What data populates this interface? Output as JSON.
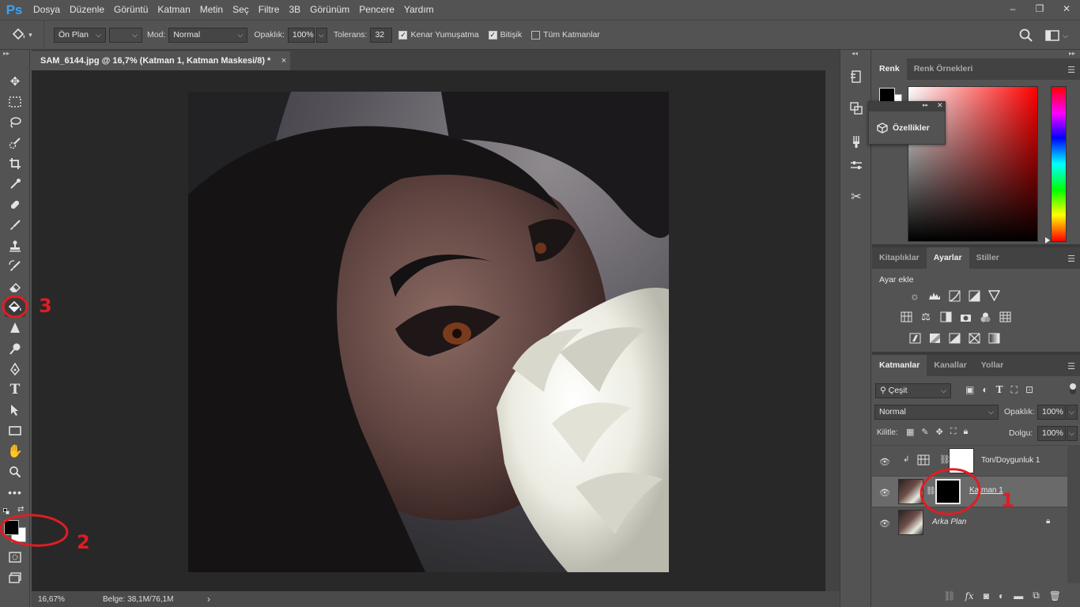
{
  "app": {
    "logo": "Ps"
  },
  "menu": [
    "Dosya",
    "Düzenle",
    "Görüntü",
    "Katman",
    "Metin",
    "Seç",
    "Filtre",
    "3B",
    "Görünüm",
    "Pencere",
    "Yardım"
  ],
  "window_controls": {
    "minimize": "–",
    "restore": "❐",
    "close": "✕"
  },
  "options": {
    "tool_icon": "paint-bucket-icon",
    "fill_source": "Ön Plan",
    "mode_label": "Mod:",
    "mode_value": "Normal",
    "opacity_label": "Opaklık:",
    "opacity_value": "100%",
    "tolerance_label": "Tolerans:",
    "tolerance_value": "32",
    "antialias_label": "Kenar Yumuşatma",
    "antialias_checked": true,
    "contiguous_label": "Bitişik",
    "contiguous_checked": true,
    "all_layers_label": "Tüm Katmanlar",
    "all_layers_checked": false
  },
  "document": {
    "tab_title": "SAM_6144.jpg @ 16,7% (Katman 1, Katman Maskesi/8) *",
    "close": "×",
    "zoom": "16,67%",
    "doc_info": "Belge: 38,1M/76,1M",
    "status_arrow": "›"
  },
  "color_panel": {
    "tabs": [
      "Renk",
      "Renk Örnekleri"
    ],
    "active_tab": "Renk",
    "foreground_color": "#000000",
    "background_color": "#ffffff",
    "picked_hue": "#ff0000"
  },
  "properties_popup": {
    "label": "Özellikler"
  },
  "adjustments_panel": {
    "tabs": [
      "Kitaplıklar",
      "Ayarlar",
      "Stiller"
    ],
    "active_tab": "Ayarlar",
    "heading": "Ayar ekle"
  },
  "layers_panel": {
    "tabs": [
      "Katmanlar",
      "Kanallar",
      "Yollar"
    ],
    "active_tab": "Katmanlar",
    "filter_kind": "Çeşit",
    "blend_mode": "Normal",
    "opacity_label": "Opaklık:",
    "opacity_value": "100%",
    "lock_label": "Kilitle:",
    "fill_label": "Dolgu:",
    "fill_value": "100%",
    "layers": [
      {
        "name": "Ton/Doygunluk 1",
        "type": "adjustment",
        "selected": false
      },
      {
        "name": "Katman 1",
        "type": "pixel-with-mask",
        "selected": true
      },
      {
        "name": "Arka Plan",
        "type": "background",
        "selected": false,
        "locked": true
      }
    ]
  },
  "annotations": [
    "1",
    "2",
    "3"
  ],
  "colors": {
    "accent": "#3aa3f5",
    "annotation_red": "#e01d22",
    "panel_bg": "#535353",
    "canvas_bg": "#282828"
  }
}
